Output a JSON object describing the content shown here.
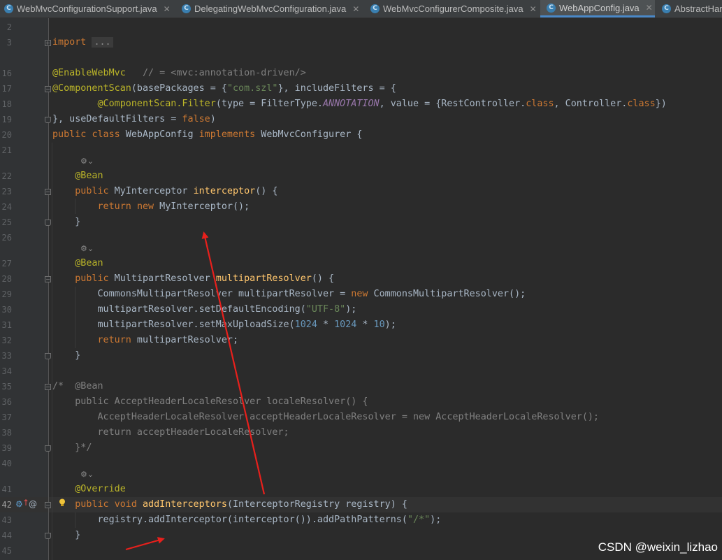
{
  "tabs": [
    {
      "label": "WebMvcConfigurationSupport.java",
      "active": false,
      "closable": true
    },
    {
      "label": "DelegatingWebMvcConfiguration.java",
      "active": false,
      "closable": true
    },
    {
      "label": "WebMvcConfigurerComposite.java",
      "active": false,
      "closable": true
    },
    {
      "label": "WebAppConfig.java",
      "active": true,
      "closable": true
    },
    {
      "label": "AbstractHar",
      "active": false,
      "closable": false
    }
  ],
  "tab_icon_letter": "C",
  "current_line": "42",
  "lines": [
    {
      "n": "2",
      "t": ""
    },
    {
      "n": "3",
      "t": "import ..."
    },
    {
      "n": "16",
      "t": "@EnableWebMvc   // = <mvc:annotation-driven/>"
    },
    {
      "n": "17",
      "t": "@ComponentScan(basePackages = {\"com.szl\"}, includeFilters = {"
    },
    {
      "n": "18",
      "t": "        @ComponentScan.Filter(type = FilterType.ANNOTATION, value = {RestController.class, Controller.class})"
    },
    {
      "n": "19",
      "t": "}, useDefaultFilters = false)"
    },
    {
      "n": "20",
      "t": "public class WebAppConfig implements WebMvcConfigurer {"
    },
    {
      "n": "21",
      "t": ""
    },
    {
      "n": "22",
      "t": "    @Bean"
    },
    {
      "n": "23",
      "t": "    public MyInterceptor interceptor() {"
    },
    {
      "n": "24",
      "t": "        return new MyInterceptor();"
    },
    {
      "n": "25",
      "t": "    }"
    },
    {
      "n": "26",
      "t": ""
    },
    {
      "n": "27",
      "t": "    @Bean"
    },
    {
      "n": "28",
      "t": "    public MultipartResolver multipartResolver() {"
    },
    {
      "n": "29",
      "t": "        CommonsMultipartResolver multipartResolver = new CommonsMultipartResolver();"
    },
    {
      "n": "30",
      "t": "        multipartResolver.setDefaultEncoding(\"UTF-8\");"
    },
    {
      "n": "31",
      "t": "        multipartResolver.setMaxUploadSize(1024 * 1024 * 10);"
    },
    {
      "n": "32",
      "t": "        return multipartResolver;"
    },
    {
      "n": "33",
      "t": "    }"
    },
    {
      "n": "34",
      "t": ""
    },
    {
      "n": "35",
      "t": "/*  @Bean"
    },
    {
      "n": "36",
      "t": "    public AcceptHeaderLocaleResolver localeResolver() {"
    },
    {
      "n": "37",
      "t": "        AcceptHeaderLocaleResolver acceptHeaderLocaleResolver = new AcceptHeaderLocaleResolver();"
    },
    {
      "n": "38",
      "t": "        return acceptHeaderLocaleResolver;"
    },
    {
      "n": "39",
      "t": "    }*/"
    },
    {
      "n": "40",
      "t": ""
    },
    {
      "n": "41",
      "t": "    @Override"
    },
    {
      "n": "42",
      "t": "    public void addInterceptors(InterceptorRegistry registry) {"
    },
    {
      "n": "43",
      "t": "        registry.addInterceptor(interceptor()).addPathPatterns(\"/*\");"
    },
    {
      "n": "44",
      "t": "    }"
    },
    {
      "n": "45",
      "t": ""
    }
  ],
  "inlay_hint": "⚙⌄",
  "watermark": "CSDN @weixin_lizhao",
  "colors": {
    "keyword": "#cc7832",
    "annotation": "#bbb529",
    "string": "#6a8759",
    "number": "#6897bb",
    "method": "#ffc66d",
    "constant": "#9876aa",
    "comment": "#808080",
    "text": "#a9b7c6",
    "arrow": "#e8201c",
    "tab_active_underline": "#4a88c7"
  }
}
